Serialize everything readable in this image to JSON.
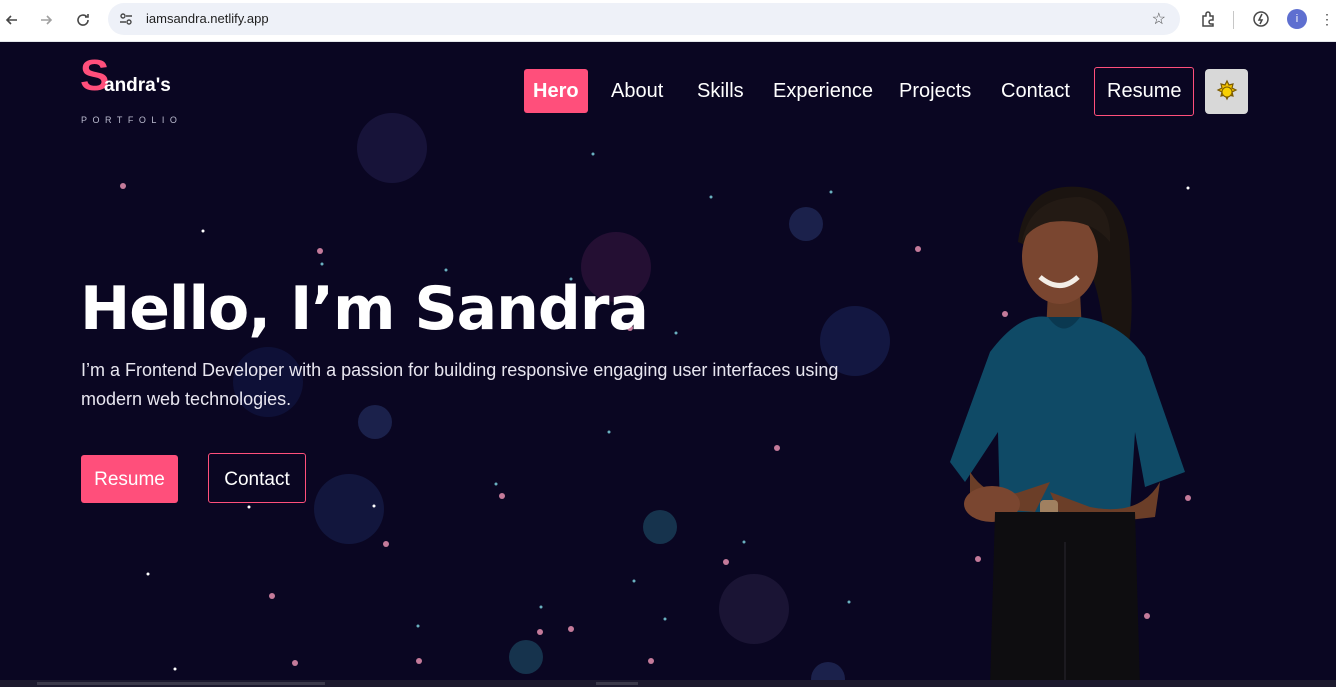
{
  "browser": {
    "url": "iamsandra.netlify.app",
    "profile_initial": "i"
  },
  "logo": {
    "initial": "S",
    "rest": "andra's",
    "subtitle": "PORTFOLIO"
  },
  "nav": {
    "items": [
      "Hero",
      "About",
      "Skills",
      "Experience",
      "Projects",
      "Contact",
      "Resume"
    ],
    "active": "Hero"
  },
  "hero": {
    "title": "Hello, I’m Sandra",
    "description": "I’m a Frontend Developer with a passion for building responsive engaging user interfaces using modern web technologies.",
    "primary_button": "Resume",
    "secondary_button": "Contact"
  },
  "colors": {
    "accent": "#ff4f7b",
    "background": "#0a0622",
    "portrait_top": "#0f4a66"
  }
}
